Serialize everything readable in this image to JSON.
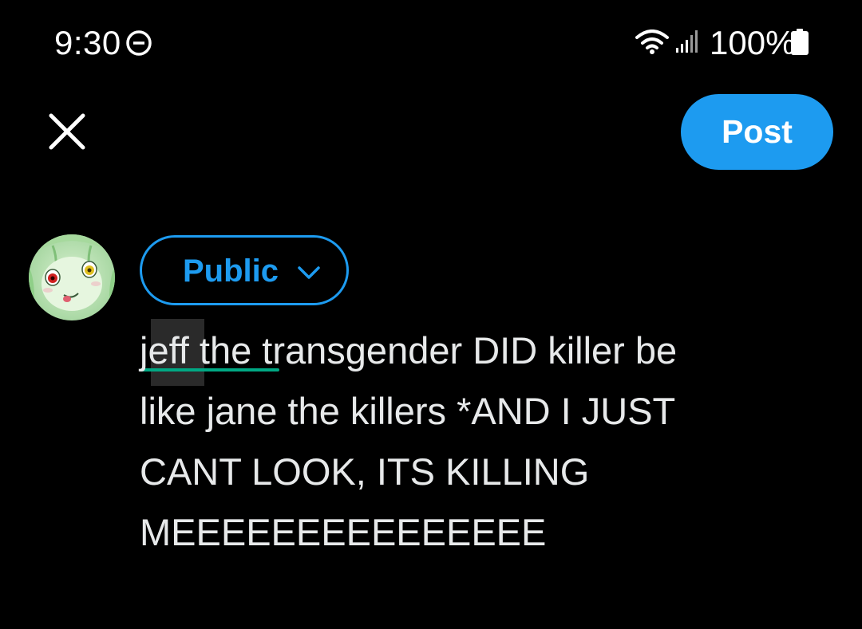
{
  "status_bar": {
    "time": "9:30",
    "battery": "100%",
    "icons": [
      "do-not-disturb-icon",
      "wifi-icon",
      "signal-icon",
      "battery-icon"
    ]
  },
  "toolbar": {
    "close_icon": "close-icon",
    "post_label": "Post"
  },
  "composer": {
    "audience_label": "Public",
    "text_lines": [
      "jeff the transgender DID killer be",
      "like jane the killers *AND I JUST",
      "CANT LOOK, ITS KILLING",
      "MEEEEEEEEEEEEEEE"
    ]
  },
  "colors": {
    "accent": "#1d9bf0",
    "background": "#000000",
    "text": "#e7e9ea",
    "spellcheck_underline": "#00a884"
  }
}
